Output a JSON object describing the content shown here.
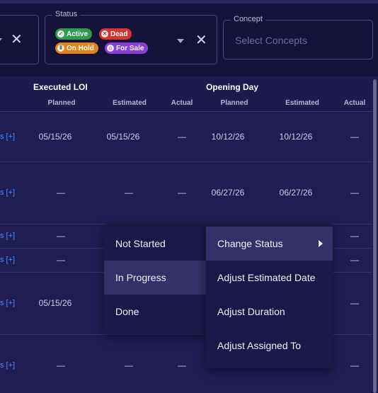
{
  "filters": {
    "status": {
      "legend": "Status",
      "chips": [
        {
          "label": "Active",
          "icon": "check-circle-icon",
          "color": "#2e9b4f"
        },
        {
          "label": "Dead",
          "icon": "x-circle-icon",
          "color": "#d8342f"
        },
        {
          "label": "On Hold",
          "icon": "pause-circle-icon",
          "color": "#e0841b"
        },
        {
          "label": "For Sale",
          "icon": "tag-icon",
          "color": "#8b3fd9"
        }
      ]
    },
    "concept": {
      "legend": "Concept",
      "placeholder": "Select Concepts"
    }
  },
  "table": {
    "groups": {
      "executed_loi": "Executed LOI",
      "opening_day": "Opening Day"
    },
    "subheaders": {
      "planned": "Planned",
      "estimated": "Estimated",
      "actual": "Actual"
    },
    "rows": [
      {
        "link": "s [+]",
        "loi_planned": "05/15/26",
        "loi_estimated": "05/15/26",
        "loi_actual": "—",
        "od_planned": "10/12/26",
        "od_estimated": "10/12/26",
        "od_actual": "—"
      },
      {
        "link": "s [+]",
        "loi_planned": "—",
        "loi_estimated": "—",
        "loi_actual": "—",
        "od_planned": "06/27/26",
        "od_estimated": "06/27/26",
        "od_actual": "—"
      },
      {
        "link": "s [+]",
        "loi_planned": "—",
        "od_actual": "—"
      },
      {
        "link": "s [+]",
        "loi_planned": "—",
        "od_actual": "—"
      },
      {
        "link": "s [+]",
        "loi_planned": "05/15/26",
        "od_actual": "—"
      },
      {
        "link": "s [+]",
        "loi_planned": "—",
        "loi_estimated": "—",
        "loi_actual": "—",
        "od_actual": "—"
      }
    ]
  },
  "context_menu": {
    "status_options": [
      "Not Started",
      "In Progress",
      "Done"
    ],
    "actions": [
      "Change Status",
      "Adjust Estimated Date",
      "Adjust Duration",
      "Adjust Assigned To"
    ]
  }
}
